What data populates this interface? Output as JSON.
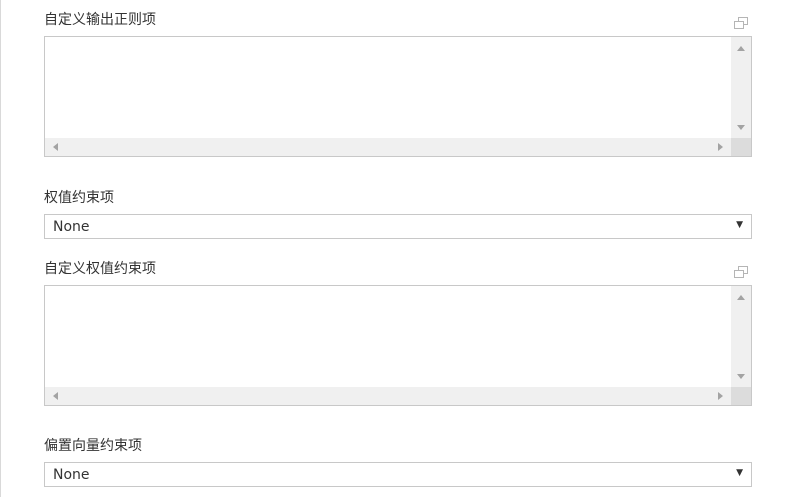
{
  "form": {
    "fields": [
      {
        "label": "自定义输出正则项",
        "type": "textarea",
        "value": ""
      },
      {
        "label": "权值约束项",
        "type": "select",
        "value": "None"
      },
      {
        "label": "自定义权值约束项",
        "type": "textarea",
        "value": ""
      },
      {
        "label": "偏置向量约束项",
        "type": "select",
        "value": "None"
      }
    ]
  },
  "icons": {
    "expand": "expand-window-icon",
    "scroll_up": "arrow-up-icon",
    "scroll_down": "arrow-down-icon",
    "scroll_left": "arrow-left-icon",
    "scroll_right": "arrow-right-icon",
    "dropdown": "caret-down-icon"
  },
  "colors": {
    "border": "#c8c8c8",
    "scrollbar": "#f0f0f0",
    "text": "#333333"
  }
}
